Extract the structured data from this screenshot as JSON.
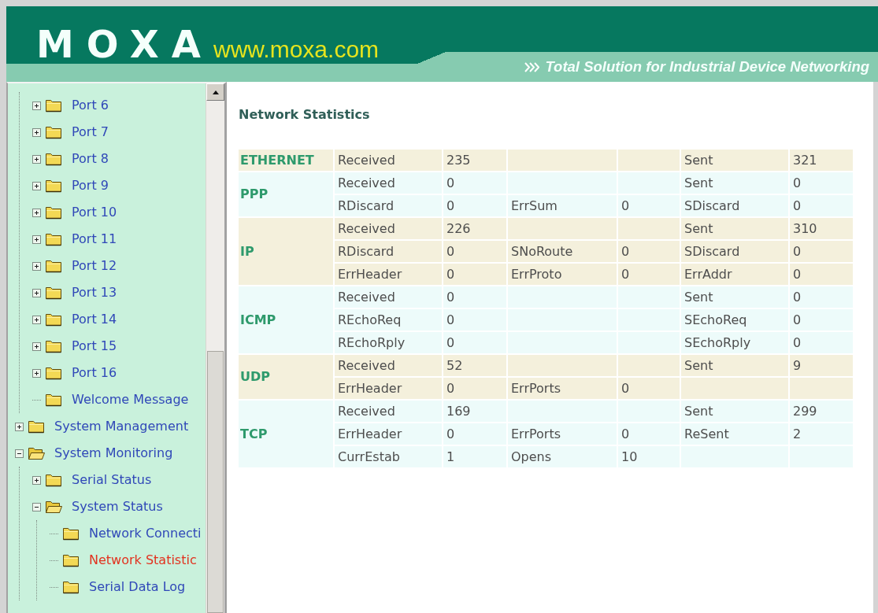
{
  "header": {
    "logo": "MOXA",
    "website": "www.moxa.com",
    "tagline": "Total Solution for Industrial Device Networking"
  },
  "sidebar": {
    "tree": [
      {
        "children": [
          {
            "label": "Port 6",
            "kind": "node",
            "expanded": false,
            "selected": false
          },
          {
            "label": "Port 7",
            "kind": "node",
            "expanded": false,
            "selected": false
          },
          {
            "label": "Port 8",
            "kind": "node",
            "expanded": false,
            "selected": false
          },
          {
            "label": "Port 9",
            "kind": "node",
            "expanded": false,
            "selected": false
          },
          {
            "label": "Port 10",
            "kind": "node",
            "expanded": false,
            "selected": false
          },
          {
            "label": "Port 11",
            "kind": "node",
            "expanded": false,
            "selected": false
          },
          {
            "label": "Port 12",
            "kind": "node",
            "expanded": false,
            "selected": false
          },
          {
            "label": "Port 13",
            "kind": "node",
            "expanded": false,
            "selected": false
          },
          {
            "label": "Port 14",
            "kind": "node",
            "expanded": false,
            "selected": false
          },
          {
            "label": "Port 15",
            "kind": "node",
            "expanded": false,
            "selected": false
          },
          {
            "label": "Port 16",
            "kind": "node",
            "expanded": false,
            "selected": false
          },
          {
            "label": "Welcome Message",
            "kind": "leaf",
            "selected": false
          }
        ]
      },
      {
        "label": "System Management",
        "kind": "node",
        "expanded": false,
        "selected": false
      },
      {
        "label": "System Monitoring",
        "kind": "node",
        "expanded": true,
        "selected": false,
        "children": [
          {
            "label": "Serial Status",
            "kind": "node",
            "expanded": false,
            "selected": false
          },
          {
            "label": "System Status",
            "kind": "node",
            "expanded": true,
            "selected": false,
            "children": [
              {
                "label": "Network Connecti",
                "kind": "leaf",
                "selected": false
              },
              {
                "label": "Network Statistic",
                "kind": "leaf",
                "selected": true
              },
              {
                "label": "Serial Data Log",
                "kind": "leaf",
                "selected": false
              }
            ]
          }
        ]
      }
    ]
  },
  "content": {
    "title": "Network Statistics",
    "table": {
      "groups": [
        {
          "protocol": "ETHERNET",
          "rows": [
            {
              "left": {
                "label": "Received",
                "value": "235"
              },
              "right": {
                "label": "Sent",
                "value": "321"
              }
            }
          ]
        },
        {
          "protocol": "PPP",
          "rows": [
            {
              "left": {
                "label": "Received",
                "value": "0"
              },
              "right": {
                "label": "Sent",
                "value": "0"
              }
            },
            {
              "left": {
                "label": "RDiscard",
                "value": "0"
              },
              "middle": {
                "label": "ErrSum",
                "value": "0"
              },
              "right": {
                "label": "SDiscard",
                "value": "0"
              }
            }
          ]
        },
        {
          "protocol": "IP",
          "rows": [
            {
              "left": {
                "label": "Received",
                "value": "226"
              },
              "right": {
                "label": "Sent",
                "value": "310"
              }
            },
            {
              "left": {
                "label": "RDiscard",
                "value": "0"
              },
              "middle": {
                "label": "SNoRoute",
                "value": "0"
              },
              "right": {
                "label": "SDiscard",
                "value": "0"
              }
            },
            {
              "left": {
                "label": "ErrHeader",
                "value": "0"
              },
              "middle": {
                "label": "ErrProto",
                "value": "0"
              },
              "right": {
                "label": "ErrAddr",
                "value": "0"
              }
            }
          ]
        },
        {
          "protocol": "ICMP",
          "rows": [
            {
              "left": {
                "label": "Received",
                "value": "0"
              },
              "right": {
                "label": "Sent",
                "value": "0"
              }
            },
            {
              "left": {
                "label": "REchoReq",
                "value": "0"
              },
              "right": {
                "label": "SEchoReq",
                "value": "0"
              }
            },
            {
              "left": {
                "label": "REchoRply",
                "value": "0"
              },
              "right": {
                "label": "SEchoRply",
                "value": "0"
              }
            }
          ]
        },
        {
          "protocol": "UDP",
          "rows": [
            {
              "left": {
                "label": "Received",
                "value": "52"
              },
              "right": {
                "label": "Sent",
                "value": "9"
              }
            },
            {
              "left": {
                "label": "ErrHeader",
                "value": "0"
              },
              "middle": {
                "label": "ErrPorts",
                "value": "0"
              }
            }
          ]
        },
        {
          "protocol": "TCP",
          "rows": [
            {
              "left": {
                "label": "Received",
                "value": "169"
              },
              "right": {
                "label": "Sent",
                "value": "299"
              }
            },
            {
              "left": {
                "label": "ErrHeader",
                "value": "0"
              },
              "middle": {
                "label": "ErrPorts",
                "value": "0"
              },
              "right": {
                "label": "ReSent",
                "value": "2"
              }
            },
            {
              "left": {
                "label": "CurrEstab",
                "value": "1"
              },
              "middle": {
                "label": "Opens",
                "value": "10"
              }
            }
          ]
        }
      ]
    }
  }
}
